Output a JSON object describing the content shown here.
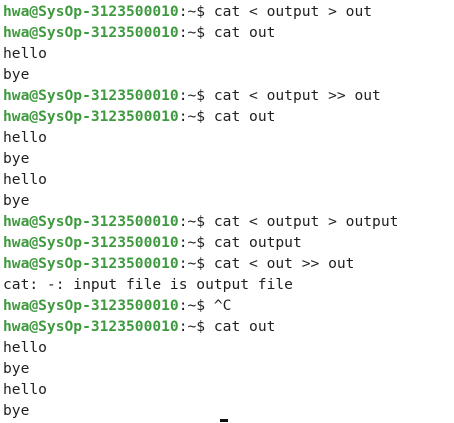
{
  "terminal": {
    "lines": [
      {
        "kind": "prompt",
        "user_host": "hwa@SysOp-3123500010",
        "path": ":~$ ",
        "command": "cat < output > out"
      },
      {
        "kind": "prompt",
        "user_host": "hwa@SysOp-3123500010",
        "path": ":~$ ",
        "command": "cat out"
      },
      {
        "kind": "output",
        "text": "hello"
      },
      {
        "kind": "output",
        "text": "bye"
      },
      {
        "kind": "prompt",
        "user_host": "hwa@SysOp-3123500010",
        "path": ":~$ ",
        "command": "cat < output >> out"
      },
      {
        "kind": "prompt",
        "user_host": "hwa@SysOp-3123500010",
        "path": ":~$ ",
        "command": "cat out"
      },
      {
        "kind": "output",
        "text": "hello"
      },
      {
        "kind": "output",
        "text": "bye"
      },
      {
        "kind": "output",
        "text": "hello"
      },
      {
        "kind": "output",
        "text": "bye"
      },
      {
        "kind": "prompt",
        "user_host": "hwa@SysOp-3123500010",
        "path": ":~$ ",
        "command": "cat < output > output"
      },
      {
        "kind": "prompt",
        "user_host": "hwa@SysOp-3123500010",
        "path": ":~$ ",
        "command": "cat output"
      },
      {
        "kind": "prompt",
        "user_host": "hwa@SysOp-3123500010",
        "path": ":~$ ",
        "command": "cat < out >> out"
      },
      {
        "kind": "output",
        "text": "cat: -: input file is output file"
      },
      {
        "kind": "prompt",
        "user_host": "hwa@SysOp-3123500010",
        "path": ":~$ ",
        "command": "^C"
      },
      {
        "kind": "prompt",
        "user_host": "hwa@SysOp-3123500010",
        "path": ":~$ ",
        "command": "cat out"
      },
      {
        "kind": "output",
        "text": "hello"
      },
      {
        "kind": "output",
        "text": "bye"
      },
      {
        "kind": "output",
        "text": "hello"
      },
      {
        "kind": "output",
        "text": "bye"
      }
    ]
  },
  "colors": {
    "background": "#ffffff",
    "prompt_user": "#3f9a3f",
    "text": "#1f1f1f"
  }
}
